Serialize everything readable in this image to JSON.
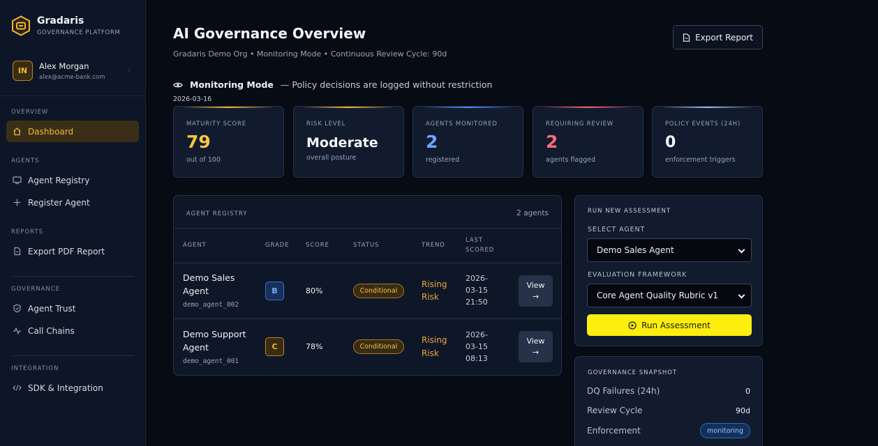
{
  "brand": {
    "name": "Gradaris",
    "subtitle": "GOVERNANCE PLATFORM"
  },
  "user": {
    "initials": "IN",
    "name": "Alex Morgan",
    "email": "alex@acme-bank.com"
  },
  "sidebar": {
    "sections": {
      "overview": "OVERVIEW",
      "agents": "AGENTS",
      "reports": "REPORTS",
      "governance": "GOVERNANCE",
      "integration": "INTEGRATION"
    },
    "items": {
      "dashboard": "Dashboard",
      "agent_registry": "Agent Registry",
      "register_agent": "Register Agent",
      "export_pdf": "Export PDF Report",
      "agent_trust": "Agent Trust",
      "call_chains": "Call Chains",
      "sdk": "SDK & Integration"
    },
    "active": "dashboard"
  },
  "header": {
    "title": "AI Governance Overview",
    "subtitle": "Gradaris Demo Org • Monitoring Mode • Continuous Review Cycle: 90d",
    "export_label": "Export Report"
  },
  "mode": {
    "title": "Monitoring Mode",
    "description": "— Policy decisions are logged without restriction",
    "date": "2026-03-16"
  },
  "stats": [
    {
      "label": "MATURITY SCORE",
      "value": "79",
      "desc": "out of 100",
      "color": "#f5c542"
    },
    {
      "label": "RISK LEVEL",
      "value": "Moderate",
      "desc": "overall posture",
      "color": "#f4f6fa"
    },
    {
      "label": "AGENTS MONITORED",
      "value": "2",
      "desc": "registered",
      "color": "#6aa8ff"
    },
    {
      "label": "REQUIRING REVIEW",
      "value": "2",
      "desc": "agents flagged",
      "color": "#ff6b7a"
    },
    {
      "label": "POLICY EVENTS (24H)",
      "value": "0",
      "desc": "enforcement triggers",
      "color": "#f4f6fa"
    }
  ],
  "registry": {
    "title": "AGENT REGISTRY",
    "count": "2 agents",
    "columns": {
      "agent": "AGENT",
      "grade": "GRADE",
      "score": "SCORE",
      "status": "STATUS",
      "trend": "TREND",
      "last_scored_1": "LAST",
      "last_scored_2": "SCORED"
    },
    "rows": [
      {
        "name": "Demo Sales Agent",
        "id": "demo_agent_002",
        "grade": "B",
        "score": "80%",
        "status": "Conditional",
        "trend_1": "Rising",
        "trend_2": "Risk",
        "last_1": "2026-",
        "last_2": "03-15",
        "last_3": "21:50",
        "view_1": "View",
        "view_2": "→"
      },
      {
        "name": "Demo Support Agent",
        "id": "demo_agent_001",
        "grade": "C",
        "score": "78%",
        "status": "Conditional",
        "trend_1": "Rising",
        "trend_2": "Risk",
        "last_1": "2026-",
        "last_2": "03-15",
        "last_3": "08:13",
        "view_1": "View",
        "view_2": "→"
      }
    ]
  },
  "assessment": {
    "title": "RUN NEW ASSESSMENT",
    "agent_label": "SELECT AGENT",
    "agent_value": "Demo Sales Agent",
    "framework_label": "EVALUATION FRAMEWORK",
    "framework_value": "Core Agent Quality Rubric v1",
    "run_label": "Run Assessment"
  },
  "snapshot": {
    "title": "GOVERNANCE SNAPSHOT",
    "dq_label": "DQ Failures (24h)",
    "dq_value": "0",
    "cycle_label": "Review Cycle",
    "cycle_value": "90d",
    "enforcement_label": "Enforcement",
    "enforcement_value": "monitoring"
  }
}
